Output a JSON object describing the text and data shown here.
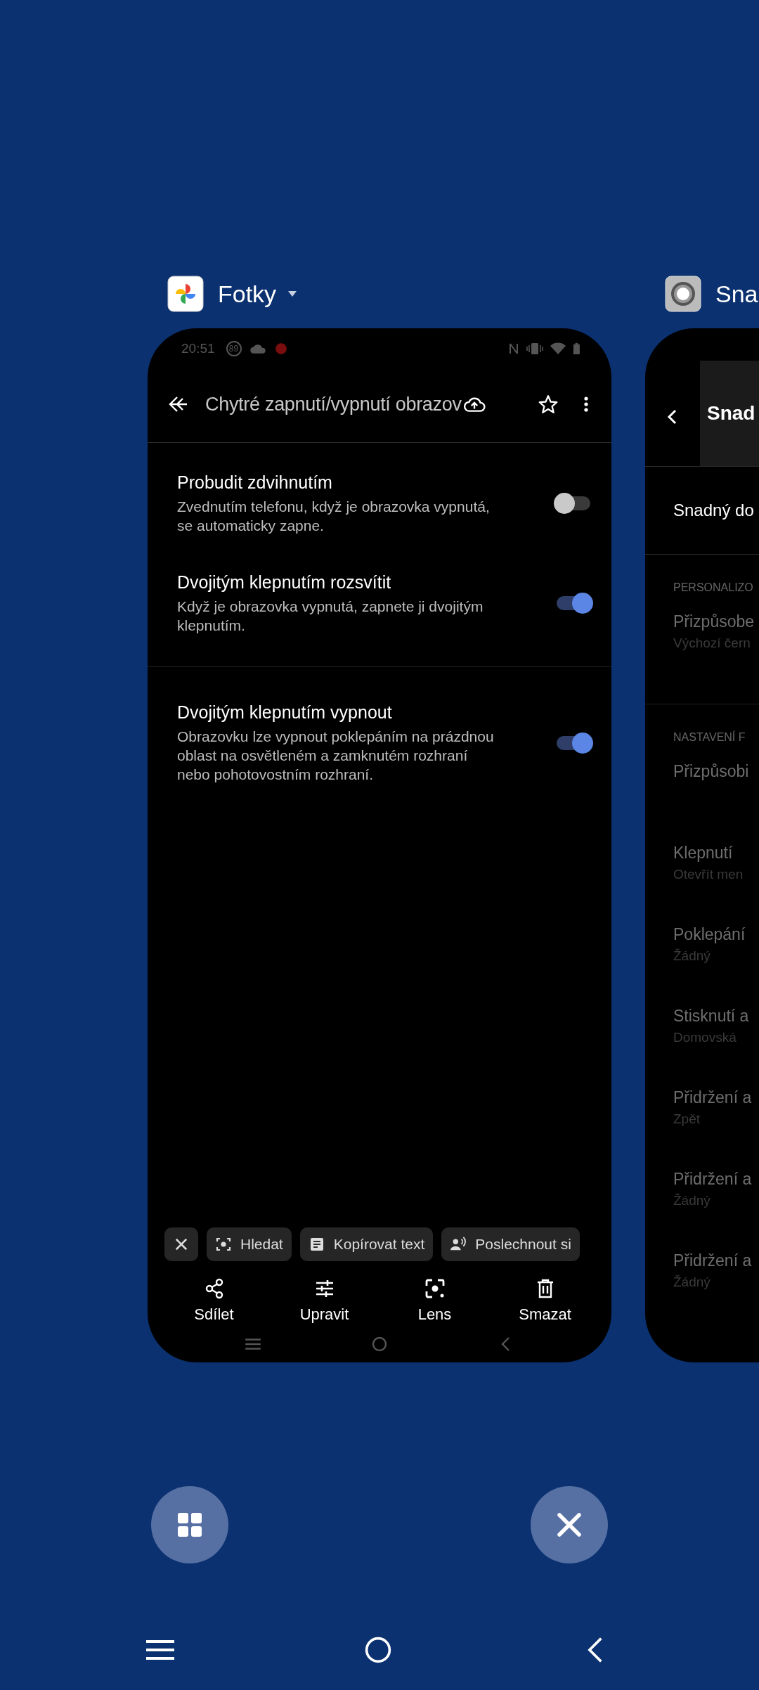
{
  "photos_card": {
    "app_label": "Fotky",
    "status_bar": {
      "time": "20:51",
      "badge": "89"
    },
    "toolbar": {
      "title": "Chytré zapnutí/vypnutí obrazov"
    },
    "groups": [
      {
        "items": [
          {
            "title": "Probudit zdvihnutím",
            "description": "Zvednutím telefonu, když je obrazovka vypnutá, se automaticky zapne.",
            "on": false
          },
          {
            "title": "Dvojitým klepnutím rozsvítit",
            "description": "Když je obrazovka vypnutá, zapnete ji dvojitým klepnutím.",
            "on": true
          }
        ]
      },
      {
        "items": [
          {
            "title": "Dvojitým klepnutím vypnout",
            "description": "Obrazovku lze vypnout poklepáním na prázdnou oblast na osvětleném a zamknutém rozhraní nebo pohotovostním rozhraní.",
            "on": true
          }
        ]
      }
    ],
    "chips": [
      {
        "kind": "close"
      },
      {
        "kind": "search",
        "label": "Hledat"
      },
      {
        "kind": "copy",
        "label": "Kopírovat text"
      },
      {
        "kind": "listen",
        "label": "Poslechnout si"
      }
    ],
    "actions": [
      {
        "kind": "share",
        "label": "Sdílet"
      },
      {
        "kind": "edit",
        "label": "Upravit"
      },
      {
        "kind": "lens",
        "label": "Lens"
      },
      {
        "kind": "delete",
        "label": "Smazat"
      }
    ]
  },
  "assist_card": {
    "app_label": "Sna",
    "toolbar_title": "Snad",
    "header_item": "Snadný do",
    "sections": [
      {
        "heading": "PERSONALIZO",
        "items": [
          {
            "title": "Přizpůsobe",
            "subtitle": "Výchozí čern"
          }
        ]
      },
      {
        "heading": "NASTAVENÍ F",
        "items": [
          {
            "title": "Přizpůsobi"
          },
          {
            "title": "Klepnutí",
            "subtitle": "Otevřít men"
          },
          {
            "title": "Poklepání",
            "subtitle": "Žádný"
          },
          {
            "title": "Stisknutí a",
            "subtitle": "Domovská"
          },
          {
            "title": "Přidržení a",
            "subtitle": "Zpět"
          },
          {
            "title": "Přidržení a",
            "subtitle": "Žádný"
          },
          {
            "title": "Přidržení a",
            "subtitle": "Žádný"
          }
        ]
      }
    ]
  }
}
